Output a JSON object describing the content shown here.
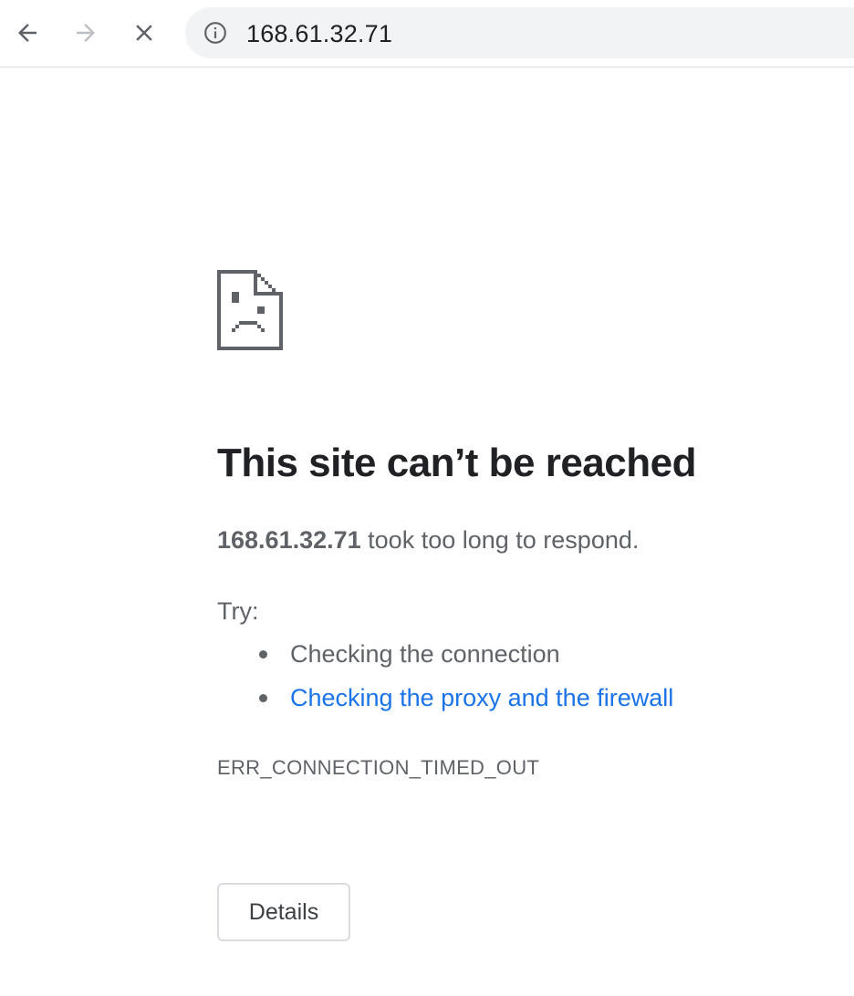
{
  "browser": {
    "back_icon": "arrow-left-icon",
    "forward_icon": "arrow-right-icon",
    "stop_icon": "close-icon",
    "info_icon": "info-icon",
    "address": "168.61.32.71",
    "forward_enabled": false
  },
  "error_page": {
    "icon": "sad-document-icon",
    "heading": "This site can’t be reached",
    "host": "168.61.32.71",
    "summary_suffix": " took too long to respond.",
    "try_label": "Try:",
    "suggestions": [
      {
        "text": "Checking the connection",
        "is_link": false
      },
      {
        "text": "Checking the proxy and the firewall",
        "is_link": true
      }
    ],
    "error_code": "ERR_CONNECTION_TIMED_OUT",
    "details_label": "Details"
  },
  "colors": {
    "heading": "#202124",
    "body_text": "#5f6368",
    "link": "#1a73e8",
    "omnibox_bg": "#f1f3f4",
    "button_border": "#dadce0"
  }
}
